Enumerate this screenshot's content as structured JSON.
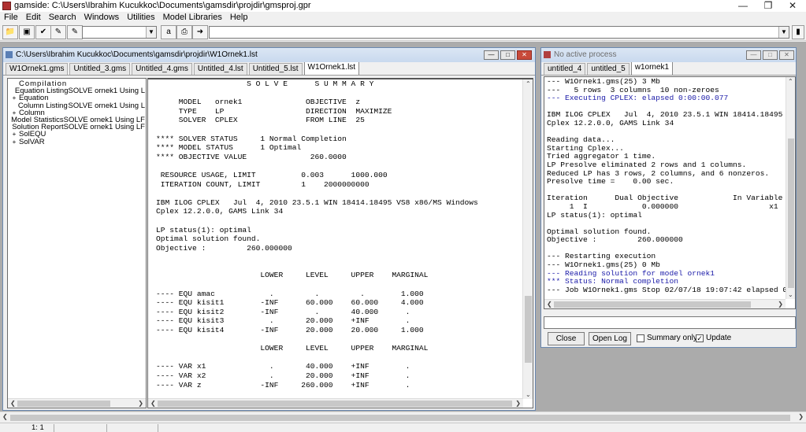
{
  "app": {
    "title": "gamside: C:\\Users\\Ibrahim Kucukkoc\\Documents\\gamsdir\\projdir\\gmsproj.gpr"
  },
  "menu": [
    "File",
    "Edit",
    "Search",
    "Windows",
    "Utilities",
    "Model Libraries",
    "Help"
  ],
  "toolbar": {
    "combo1_value": "",
    "a_label": "a",
    "combo2_value": ""
  },
  "listing": {
    "title": "C:\\Users\\Ibrahim Kucukkoc\\Documents\\gamsdir\\projdir\\W1Ornek1.lst",
    "tabs": [
      "W1Ornek1.gms",
      "Untitled_3.gms",
      "Untitled_4.gms",
      "Untitled_4.lst",
      "Untitled_5.lst",
      "W1Ornek1.lst"
    ],
    "tree": [
      {
        "label": "Compilation",
        "detail": "",
        "expander": ""
      },
      {
        "label": "Equation Listing",
        "detail": "SOLVE ornek1 Using L",
        "expander": ""
      },
      {
        "label": "Equation",
        "detail": "",
        "expander": "+"
      },
      {
        "label": "Column Listing",
        "detail": "SOLVE ornek1 Using L",
        "expander": ""
      },
      {
        "label": "Column",
        "detail": "",
        "expander": "+"
      },
      {
        "label": "Model Statistics",
        "detail": "SOLVE ornek1 Using LF",
        "expander": ""
      },
      {
        "label": "Solution Report",
        "detail": "SOLVE ornek1 Using LF",
        "expander": ""
      },
      {
        "label": "SolEQU",
        "detail": "",
        "expander": "+"
      },
      {
        "label": "SolVAR",
        "detail": "",
        "expander": "+"
      }
    ],
    "lines": [
      "                    S O L V E      S U M M A R Y",
      "",
      "     MODEL   ornek1              OBJECTIVE  z",
      "     TYPE    LP                  DIRECTION  MAXIMIZE",
      "     SOLVER  CPLEX               FROM LINE  25",
      "",
      "**** SOLVER STATUS     1 Normal Completion",
      "**** MODEL STATUS      1 Optimal",
      "**** OBJECTIVE VALUE              260.0000",
      "",
      " RESOURCE USAGE, LIMIT          0.003      1000.000",
      " ITERATION COUNT, LIMIT         1    2000000000",
      "",
      "IBM ILOG CPLEX   Jul  4, 2010 23.5.1 WIN 18414.18495 VS8 x86/MS Windows",
      "Cplex 12.2.0.0, GAMS Link 34",
      "",
      "LP status(1): optimal",
      "Optimal solution found.",
      "Objective :         260.000000",
      "",
      "",
      "                       LOWER     LEVEL     UPPER    MARGINAL",
      "",
      "---- EQU amac            .         .         .        1.000",
      "---- EQU kisit1        -INF      60.000    60.000     4.000",
      "---- EQU kisit2        -INF        .       40.000      .",
      "---- EQU kisit3          .       20.000    +INF        .",
      "---- EQU kisit4        -INF      20.000    20.000     1.000",
      "",
      "                       LOWER     LEVEL     UPPER    MARGINAL",
      "",
      "---- VAR x1              .       40.000    +INF        .",
      "---- VAR x2              .       20.000    +INF        .",
      "---- VAR z             -INF     260.000    +INF        ."
    ]
  },
  "process": {
    "title": "No active process",
    "tabs": [
      "untitled_4",
      "untitled_5",
      "w1ornek1"
    ],
    "lines": [
      {
        "text": "--- W1Ornek1.gms(25) 3 Mb",
        "blue": false
      },
      {
        "text": "---   5 rows  3 columns  10 non-zeroes",
        "blue": false
      },
      {
        "text": "--- Executing CPLEX: elapsed 0:00:00.077",
        "blue": true
      },
      {
        "text": "",
        "blue": false
      },
      {
        "text": "IBM ILOG CPLEX   Jul  4, 2010 23.5.1 WIN 18414.18495 VS8 x",
        "blue": false
      },
      {
        "text": "Cplex 12.2.0.0, GAMS Link 34",
        "blue": false
      },
      {
        "text": "",
        "blue": false
      },
      {
        "text": "Reading data...",
        "blue": false
      },
      {
        "text": "Starting Cplex...",
        "blue": false
      },
      {
        "text": "Tried aggregator 1 time.",
        "blue": false
      },
      {
        "text": "LP Presolve eliminated 2 rows and 1 columns.",
        "blue": false
      },
      {
        "text": "Reduced LP has 3 rows, 2 columns, and 6 nonzeros.",
        "blue": false
      },
      {
        "text": "Presolve time =    0.00 sec.",
        "blue": false
      },
      {
        "text": "",
        "blue": false
      },
      {
        "text": "Iteration      Dual Objective            In Variable",
        "blue": false
      },
      {
        "text": "     1  I            0.000000                    x1",
        "blue": false
      },
      {
        "text": "LP status(1): optimal",
        "blue": false
      },
      {
        "text": "",
        "blue": false
      },
      {
        "text": "Optimal solution found.",
        "blue": false
      },
      {
        "text": "Objective :         260.000000",
        "blue": false
      },
      {
        "text": "",
        "blue": false
      },
      {
        "text": "--- Restarting execution",
        "blue": false
      },
      {
        "text": "--- W1Ornek1.gms(25) 0 Mb",
        "blue": false
      },
      {
        "text": "--- Reading solution for model ornek1",
        "blue": true
      },
      {
        "text": "*** Status: Normal completion",
        "blue": true
      },
      {
        "text": "--- Job W1Ornek1.gms Stop 02/07/18 19:07:42 elapsed 0:00:0",
        "blue": false
      }
    ],
    "input_value": "",
    "close_label": "Close",
    "openlog_label": "Open Log",
    "summary_label": "Summary only",
    "summary_checked": false,
    "update_label": "Update",
    "update_checked": true
  },
  "status": {
    "position": "1: 1"
  }
}
